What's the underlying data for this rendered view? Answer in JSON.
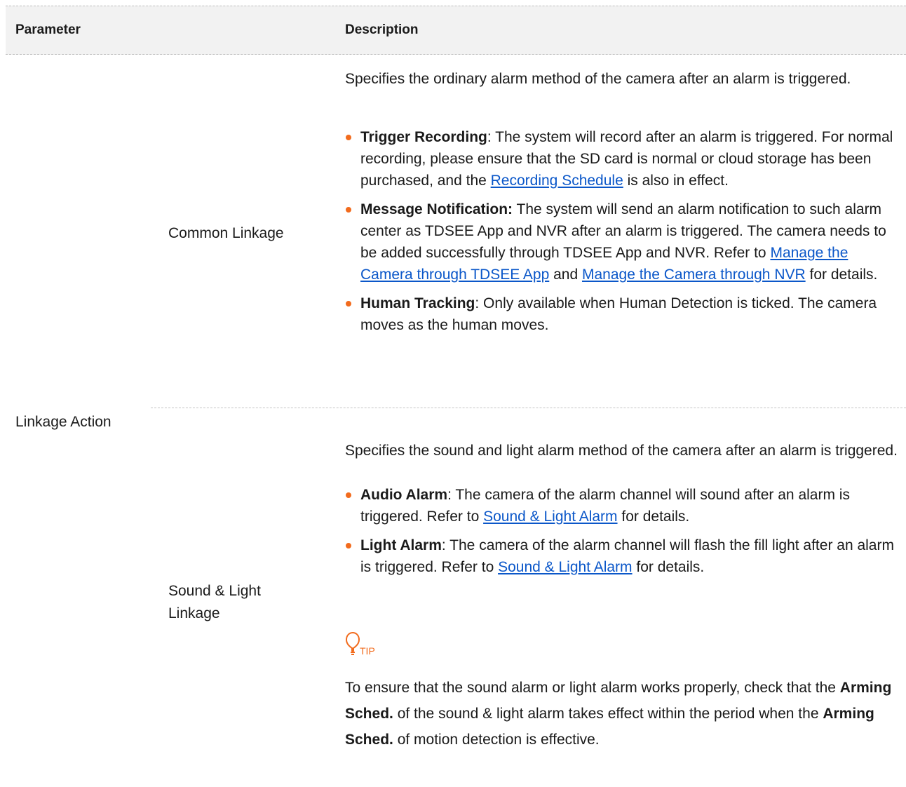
{
  "header": {
    "parameter": "Parameter",
    "description": "Description"
  },
  "param": {
    "main": "Linkage Action",
    "common": "Common Linkage",
    "sound_light": "Sound & Light Linkage"
  },
  "common": {
    "intro": "Specifies the ordinary alarm method of the camera after an alarm is triggered.",
    "b1": {
      "title": "Trigger Recording",
      "text": ": The system will record after an alarm is triggered. For normal recording, please ensure that the SD card is normal or cloud storage has been purchased, and the ",
      "link": "Recording Schedule",
      "tail": " is also in effect."
    },
    "b2": {
      "title": "Message Notification:",
      "text": " The system will send an alarm notification to such alarm center as TDSEE App and NVR after an alarm is triggered. The camera needs to be added successfully through TDSEE App and NVR. Refer to ",
      "link1": "Manage the Camera through TDSEE App",
      "mid": " and ",
      "link2": "Manage the Camera through NVR",
      "tail": " for details."
    },
    "b3": {
      "title": "Human Tracking",
      "text": ": Only available when Human Detection is ticked. The camera moves as the human moves."
    }
  },
  "sound": {
    "intro": "Specifies the sound and light alarm method of the camera after an alarm is triggered.",
    "b1": {
      "title": "Audio Alarm",
      "text": ": The camera of the alarm channel will sound after an alarm is triggered. Refer to ",
      "link": "Sound & Light Alarm",
      "tail": " for details."
    },
    "b2": {
      "title": "Light Alarm",
      "text": ": The camera of the alarm channel will flash the fill light after an alarm is triggered. Refer to ",
      "link": "Sound & Light Alarm",
      "tail": " for details."
    }
  },
  "tip": {
    "label": "TIP",
    "text1": "To ensure that the sound alarm or light alarm works properly, check that the ",
    "bold1": "Arming Sched.",
    "text2": " of the sound & light alarm takes effect within the period when the ",
    "bold2": "Arming Sched.",
    "text3": " of motion detection is effective."
  },
  "colors": {
    "accent": "#f26b1d",
    "link": "#0b57c9",
    "header_bg": "#f2f2f2"
  }
}
